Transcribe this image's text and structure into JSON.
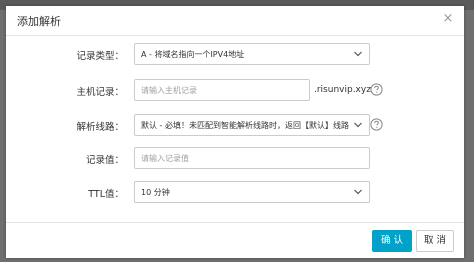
{
  "dialog": {
    "title": "添加解析",
    "close_symbol": "×"
  },
  "form": {
    "record_type": {
      "label": "记录类型：",
      "value": "A - 将域名指向一个IPV4地址",
      "icon": "chevron-down-icon"
    },
    "host_record": {
      "label": "主机记录：",
      "placeholder": "请输入主机记录",
      "suffix": ".risunvip.xyz",
      "help_icon": "question-circle-icon"
    },
    "resolution_line": {
      "label": "解析线路：",
      "value": "默认 - 必填！未匹配到智能解析线路时，返回【默认】线路...",
      "icon": "chevron-down-icon",
      "help_icon": "question-circle-icon"
    },
    "record_value": {
      "label": "记录值：",
      "placeholder": "请输入记录值"
    },
    "ttl": {
      "label": "TTL值：",
      "value": "10 分钟",
      "icon": "chevron-down-icon"
    }
  },
  "footer": {
    "confirm_label": "确 认",
    "cancel_label": "取 消"
  },
  "colors": {
    "primary": "#00a2ca",
    "border": "#cccccc",
    "overlay": "#6f6f6f"
  }
}
